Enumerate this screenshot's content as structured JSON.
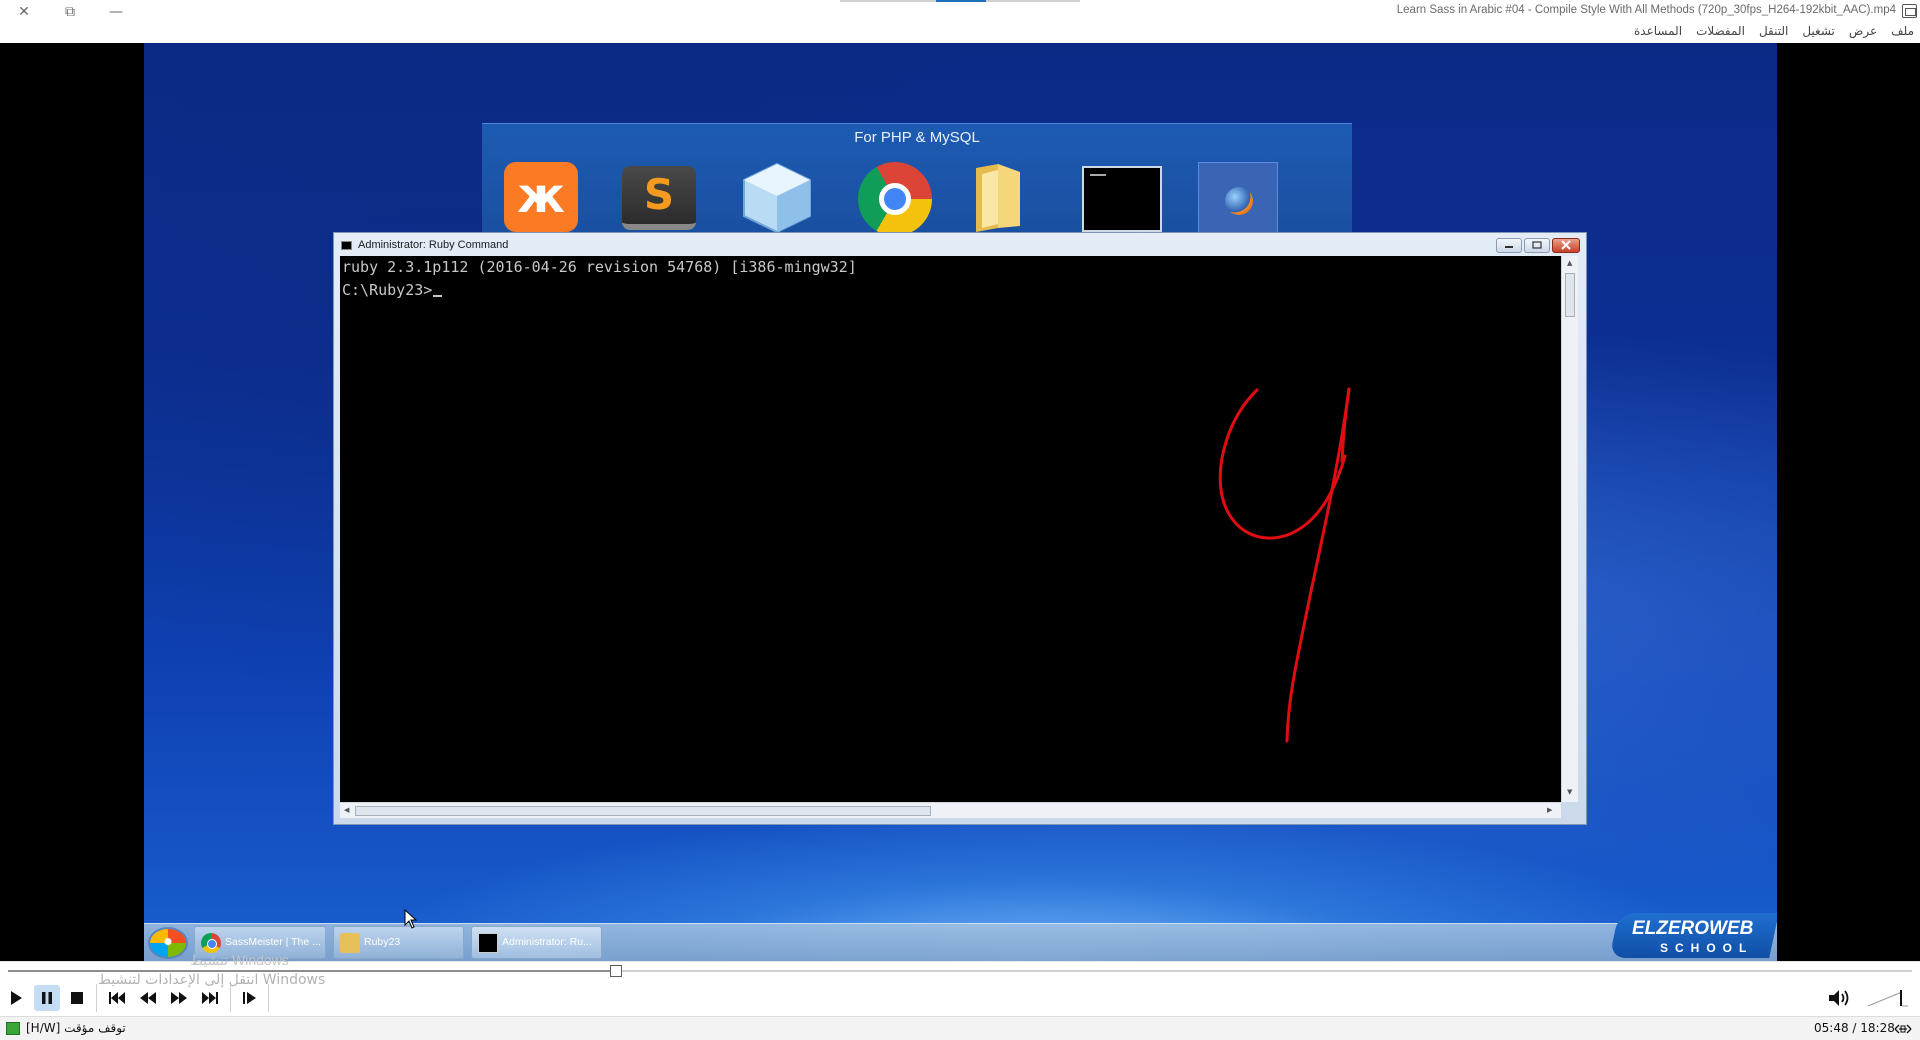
{
  "window": {
    "title": "Learn Sass in Arabic #04 - Compile Style With All Methods (720p_30fps_H264-192kbit_AAC).mp4",
    "close_glyph": "✕",
    "restore_glyph": "⧉",
    "minimize_glyph": "—"
  },
  "menu": [
    "ملف",
    "عرض",
    "تشغيل",
    "التنقل",
    "المفضلات",
    "المساعدة"
  ],
  "video": {
    "dock_title": "For PHP & MySQL",
    "dock_icons": [
      "xampp-icon",
      "sublime-text-icon",
      "netbeans-icon",
      "chrome-icon",
      "folder-icon",
      "command-prompt-icon",
      "ruby-sphere-icon"
    ],
    "console": {
      "title": "Administrator: Ruby Command",
      "lines": [
        "ruby 2.3.1p112 (2016-04-26 revision 54768) [i386-mingw32]",
        "C:\\Ruby23>"
      ],
      "annotation_color": "#e00d12"
    },
    "taskbar": {
      "items": [
        {
          "label": "SassMeister | The ...",
          "icon": "chrome-icon"
        },
        {
          "label": "Ruby23",
          "icon": "folder-icon"
        },
        {
          "label": "Administrator: Ru...",
          "icon": "command-prompt-icon"
        }
      ]
    },
    "logo": {
      "line1": "ELZEROWEB",
      "line2": "SCHOOL"
    }
  },
  "overlay": {
    "activation_line1": "تنشيط Windows",
    "activation_line2": "انتقل إلى الإعدادات لتنشيط Windows"
  },
  "player": {
    "progress": 0.3191,
    "icons": [
      "play-icon",
      "pause-icon",
      "stop-icon",
      "previous-icon",
      "rewind-icon",
      "fast-forward-icon",
      "next-icon",
      "frame-step-icon",
      "volume-icon",
      "volume-slider-icon"
    ]
  },
  "status": {
    "text": "[H/W] توقف مؤقت",
    "time": "05:48 / 18:28"
  },
  "colors": {
    "accent": "#c4dcf4",
    "desktop_blue": "#0c2f94",
    "annotation_red": "#e00d12"
  }
}
